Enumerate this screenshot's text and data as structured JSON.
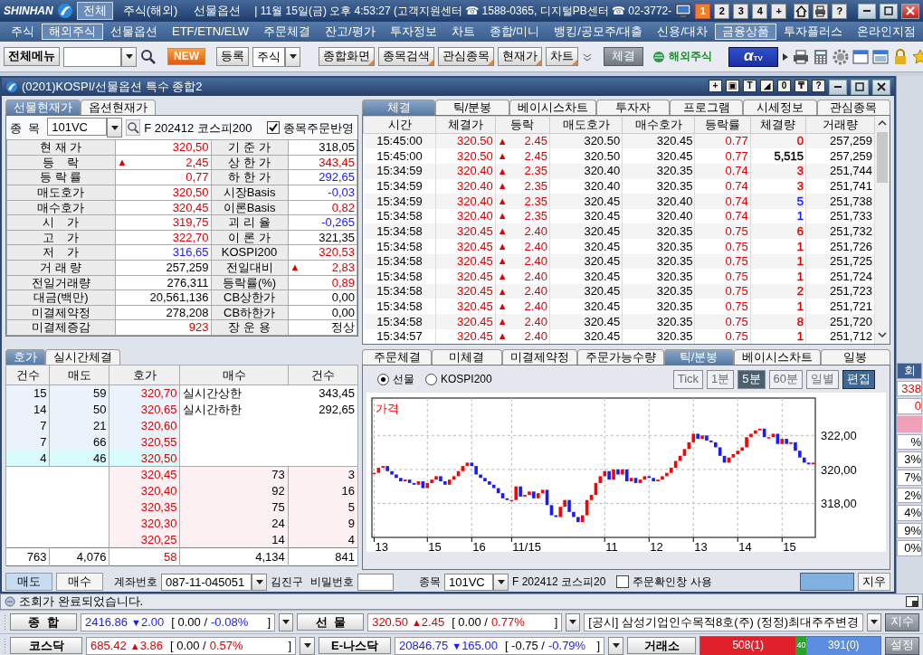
{
  "topbar": {
    "logo": "SHINHAN",
    "tabs": [
      {
        "label": "전체",
        "selected": true
      },
      {
        "label": "주식(해외)",
        "selected": false
      },
      {
        "label": "선물옵션",
        "selected": false
      }
    ],
    "info": "| 11월 15일(금) 오후 4:53:27 (고객지원센터 ☎ 1588-0365, 디지털PB센터 ☎ 02-3772-",
    "screens": [
      {
        "label": "1",
        "selected": true
      },
      {
        "label": "2",
        "selected": false
      },
      {
        "label": "3",
        "selected": false
      },
      {
        "label": "4",
        "selected": false
      },
      {
        "label": "+",
        "selected": false
      }
    ],
    "help": "?"
  },
  "menu": [
    {
      "label": "주식",
      "selected": false
    },
    {
      "label": "해외주식",
      "selected": true
    },
    {
      "label": "선물옵션",
      "selected": false
    },
    {
      "label": "ETF/ETN/ELW",
      "selected": false
    },
    {
      "label": "주문체결",
      "selected": false
    },
    {
      "label": "잔고/평가",
      "selected": false
    },
    {
      "label": "투자정보",
      "selected": false
    },
    {
      "label": "차트",
      "selected": false
    },
    {
      "label": "종합/미니",
      "selected": false
    },
    {
      "label": "뱅킹/공모주/대출",
      "selected": false
    },
    {
      "label": "신용/대차",
      "selected": false
    },
    {
      "label": "금융상품",
      "selected": true
    },
    {
      "label": "투자플러스",
      "selected": false
    },
    {
      "label": "온라인지점",
      "selected": false
    }
  ],
  "toolbar": {
    "all_menu": "전체메뉴",
    "new": "NEW",
    "register": "등록",
    "market": "주식",
    "shortcuts": [
      "종합화면",
      "종목검색",
      "관심종목",
      "현재가",
      "차트"
    ],
    "fills": "체결",
    "overseas": "해외주식",
    "tv_mark": "α",
    "tv": "TV"
  },
  "window": {
    "title": "(0201)KOSPI/선물옵션 특수 종합2",
    "tools": [
      "+",
      "▣",
      "T",
      "◢",
      "0",
      "₸",
      "?"
    ]
  },
  "quote": {
    "tabs": [
      {
        "label": "선물현재가",
        "selected": true
      },
      {
        "label": "옵션현재가",
        "selected": false
      }
    ],
    "symbol_label": "종  목",
    "symbol": "101VC",
    "symbol_name": "F 202412 코스피200",
    "reflect": {
      "label": "종목주문반영",
      "checked": true
    },
    "rows": [
      {
        "left": {
          "label": "현 재 가",
          "value": "320,50",
          "color": "#e00000"
        },
        "right": {
          "label": "기 준 가",
          "value": "318,05",
          "color": "#000000"
        }
      },
      {
        "left": {
          "label": "등    락",
          "mark": "▲",
          "value": "2,45",
          "color": "#e00000"
        },
        "right": {
          "label": "상 한 가",
          "value": "343,45",
          "color": "#e00000"
        }
      },
      {
        "left": {
          "label": "등 락 률",
          "value": "0,77",
          "color": "#e00000"
        },
        "right": {
          "label": "하 한 가",
          "value": "292,65",
          "color": "#1a1aff"
        }
      },
      {
        "left": {
          "label": "매도호가",
          "value": "320,50",
          "color": "#e00000"
        },
        "right": {
          "label": "시장Basis",
          "value": "-0,03",
          "color": "#1a1aff"
        }
      },
      {
        "left": {
          "label": "매수호가",
          "value": "320,45",
          "color": "#e00000"
        },
        "right": {
          "label": "이론Basis",
          "value": "0,82",
          "color": "#e00000"
        }
      },
      {
        "left": {
          "label": "시    가",
          "value": "319,75",
          "color": "#e00000"
        },
        "right": {
          "label": "괴 리 율",
          "value": "-0,265",
          "color": "#1a1aff"
        }
      },
      {
        "left": {
          "label": "고    가",
          "value": "322,70",
          "color": "#e00000"
        },
        "right": {
          "label": "이 론 가",
          "value": "321,35",
          "color": "#000000"
        }
      },
      {
        "left": {
          "label": "저    가",
          "value": "316,65",
          "color": "#1a1aff"
        },
        "right": {
          "label": "KOSPI200",
          "value": "320,53",
          "color": "#e00000"
        }
      },
      {
        "left": {
          "label": "거 래 량",
          "value": "257,259",
          "color": "#000000"
        },
        "right": {
          "label": "전일대비",
          "mark": "▲",
          "value": "2,83",
          "color": "#e00000"
        }
      },
      {
        "left": {
          "label": "전일거래량",
          "value": "276,311",
          "color": "#000000"
        },
        "right": {
          "label": "등락률(%)",
          "value": "0,89",
          "color": "#e00000"
        }
      },
      {
        "left": {
          "label": "대금(백만)",
          "value": "20,561,136",
          "color": "#000000"
        },
        "right": {
          "label": "CB상한가",
          "value": "0,00",
          "color": "#000000"
        }
      },
      {
        "left": {
          "label": "미결제약정",
          "value": "278,208",
          "color": "#000000"
        },
        "right": {
          "label": "CB하한가",
          "value": "0,00",
          "color": "#000000"
        }
      },
      {
        "left": {
          "label": "미결제증감",
          "value": "923",
          "color": "#e00000"
        },
        "right": {
          "label": "장 운 용",
          "value": "정상",
          "color": "#000000"
        }
      }
    ]
  },
  "trades": {
    "tabs": [
      {
        "label": "체결",
        "selected": true
      },
      {
        "label": "틱/분봉",
        "selected": false
      },
      {
        "label": "베이시스차트",
        "selected": false
      },
      {
        "label": "투자자",
        "selected": false
      },
      {
        "label": "프로그램",
        "selected": false
      },
      {
        "label": "시세정보",
        "selected": false
      },
      {
        "label": "관심종목",
        "selected": false
      }
    ],
    "columns": [
      "시간",
      "체결가",
      "등락",
      "매도호가",
      "매수호가",
      "등락률",
      "체결량",
      "거래량"
    ],
    "rows": [
      {
        "time": "15:45:00",
        "price": "320.50",
        "mark": "▲",
        "change": "2.45",
        "ask": "320.50",
        "bid": "320.45",
        "rate": "0.77",
        "qty": {
          "text": "0",
          "color": "#e00000"
        },
        "volume": "257,259"
      },
      {
        "time": "15:45:00",
        "price": "320.50",
        "mark": "▲",
        "change": "2.45",
        "ask": "320.50",
        "bid": "320.45",
        "rate": "0.77",
        "qty": {
          "text": "5,515",
          "color": "#000000"
        },
        "volume": "257,259"
      },
      {
        "time": "15:34:59",
        "price": "320.40",
        "mark": "▲",
        "change": "2.35",
        "ask": "320.40",
        "bid": "320.35",
        "rate": "0.74",
        "qty": {
          "text": "3",
          "color": "#e00000"
        },
        "volume": "251,744"
      },
      {
        "time": "15:34:59",
        "price": "320.40",
        "mark": "▲",
        "change": "2.35",
        "ask": "320.40",
        "bid": "320.35",
        "rate": "0.74",
        "qty": {
          "text": "3",
          "color": "#e00000"
        },
        "volume": "251,741"
      },
      {
        "time": "15:34:59",
        "price": "320.40",
        "mark": "▲",
        "change": "2.35",
        "ask": "320.45",
        "bid": "320.40",
        "rate": "0.74",
        "qty": {
          "text": "5",
          "color": "#1a1aff"
        },
        "volume": "251,738"
      },
      {
        "time": "15:34:58",
        "price": "320.40",
        "mark": "▲",
        "change": "2.35",
        "ask": "320.45",
        "bid": "320.40",
        "rate": "0.74",
        "qty": {
          "text": "1",
          "color": "#1a1aff"
        },
        "volume": "251,733"
      },
      {
        "time": "15:34:58",
        "price": "320.45",
        "mark": "▲",
        "change": "2.40",
        "ask": "320.45",
        "bid": "320.35",
        "rate": "0.75",
        "qty": {
          "text": "6",
          "color": "#e00000"
        },
        "volume": "251,732"
      },
      {
        "time": "15:34:58",
        "price": "320.45",
        "mark": "▲",
        "change": "2.40",
        "ask": "320.45",
        "bid": "320.35",
        "rate": "0.75",
        "qty": {
          "text": "1",
          "color": "#e00000"
        },
        "volume": "251,726"
      },
      {
        "time": "15:34:58",
        "price": "320.45",
        "mark": "▲",
        "change": "2.40",
        "ask": "320.45",
        "bid": "320.35",
        "rate": "0.75",
        "qty": {
          "text": "1",
          "color": "#e00000"
        },
        "volume": "251,725"
      },
      {
        "time": "15:34:58",
        "price": "320.45",
        "mark": "▲",
        "change": "2.40",
        "ask": "320.45",
        "bid": "320.35",
        "rate": "0.75",
        "qty": {
          "text": "1",
          "color": "#e00000"
        },
        "volume": "251,724"
      },
      {
        "time": "15:34:58",
        "price": "320.45",
        "mark": "▲",
        "change": "2.40",
        "ask": "320.45",
        "bid": "320.35",
        "rate": "0.75",
        "qty": {
          "text": "2",
          "color": "#e00000"
        },
        "volume": "251,723"
      },
      {
        "time": "15:34:58",
        "price": "320.45",
        "mark": "▲",
        "change": "2.40",
        "ask": "320.45",
        "bid": "320.35",
        "rate": "0.75",
        "qty": {
          "text": "1",
          "color": "#e00000"
        },
        "volume": "251,721"
      },
      {
        "time": "15:34:58",
        "price": "320.45",
        "mark": "▲",
        "change": "2.40",
        "ask": "320.45",
        "bid": "320.35",
        "rate": "0.75",
        "qty": {
          "text": "8",
          "color": "#e00000"
        },
        "volume": "251,720"
      },
      {
        "time": "15:34:57",
        "price": "320.45",
        "mark": "▲",
        "change": "2.40",
        "ask": "320.45",
        "bid": "320.35",
        "rate": "0.75",
        "qty": {
          "text": "1",
          "color": "#e00000"
        },
        "volume": "251,712"
      }
    ]
  },
  "orderbook": {
    "tabs": [
      {
        "label": "호가",
        "selected": true
      },
      {
        "label": "실시간체결",
        "selected": false
      }
    ],
    "columns": [
      "건수",
      "매도",
      "호가",
      "매수",
      "건수"
    ],
    "asks": [
      {
        "count": "15",
        "qty": "59",
        "price": "320,70",
        "best": false
      },
      {
        "count": "14",
        "qty": "50",
        "price": "320,65",
        "best": false
      },
      {
        "count": "7",
        "qty": "21",
        "price": "320,60",
        "best": false
      },
      {
        "count": "7",
        "qty": "66",
        "price": "320,55",
        "best": false
      },
      {
        "count": "4",
        "qty": "46",
        "price": "320,50",
        "best": true
      }
    ],
    "limits": [
      {
        "label": "실시간상한",
        "value": "343,45"
      },
      {
        "label": "실시간하한",
        "value": "292,65"
      }
    ],
    "bids": [
      {
        "price": "320,45",
        "qty": "73",
        "count": "3"
      },
      {
        "price": "320,40",
        "qty": "92",
        "count": "16"
      },
      {
        "price": "320,35",
        "qty": "75",
        "count": "5"
      },
      {
        "price": "320,30",
        "qty": "24",
        "count": "9"
      },
      {
        "price": "320,25",
        "qty": "14",
        "count": "4"
      }
    ],
    "totals": [
      "763",
      "4,076",
      "58",
      "4,134",
      "841"
    ]
  },
  "chart_panel": {
    "tabs": [
      {
        "label": "주문체결",
        "selected": false
      },
      {
        "label": "미체결",
        "selected": false
      },
      {
        "label": "미결제약정",
        "selected": false
      },
      {
        "label": "주문가능수량",
        "selected": false
      },
      {
        "label": "틱/분봉",
        "selected": true
      },
      {
        "label": "베이시스차트",
        "selected": false
      },
      {
        "label": "일봉",
        "selected": false
      }
    ],
    "sources": [
      {
        "label": "선물",
        "selected": true
      },
      {
        "label": "KOSPI200",
        "selected": false
      }
    ],
    "periods": [
      {
        "label": "Tick",
        "selected": false
      },
      {
        "label": "1분",
        "selected": false
      },
      {
        "label": "5분",
        "selected": true
      },
      {
        "label": "60분",
        "selected": false
      },
      {
        "label": "일별",
        "selected": false
      }
    ],
    "edit": "편집",
    "chart": {
      "label": "가격",
      "y_labels": [
        "322,00",
        "320,00",
        "318,00"
      ],
      "x_labels": [
        "13",
        "15",
        "16",
        "11/15",
        "11",
        "12",
        "13",
        "14",
        "15"
      ]
    }
  },
  "order": {
    "sides": [
      {
        "label": "매도",
        "selected": true
      },
      {
        "label": "매수",
        "selected": false
      }
    ],
    "account_label": "계좌번호",
    "account": "087-11-045051",
    "owner": "김진구",
    "password_label": "비밀번호",
    "symbol_label": "종목",
    "symbol": "101VC",
    "symbol_name": "F 202412 코스피20",
    "confirm": {
      "label": "주문확인창 사용",
      "checked": false
    },
    "clear": "지우"
  },
  "side_strip": [
    {
      "text": "회",
      "kind": "header"
    },
    {
      "text": "338",
      "kind": "up"
    },
    {
      "text": "0",
      "kind": "up"
    },
    {
      "text": "%",
      "kind": "plain"
    },
    {
      "text": "3%",
      "kind": "plain"
    },
    {
      "text": "7%",
      "kind": "plain"
    },
    {
      "text": "2%",
      "kind": "plain"
    },
    {
      "text": "4%",
      "kind": "plain"
    },
    {
      "text": "9%",
      "kind": "plain"
    },
    {
      "text": "0%",
      "kind": "plain"
    }
  ],
  "status": "조회가 완료되었습니다.",
  "tickers": [
    {
      "items": [
        {
          "label": "종  합",
          "value": "2416.86",
          "color": "#1a1aff",
          "mark": "▼",
          "change": "2.00",
          "net": "[ 0.00 /",
          "pct": {
            "text": "-0.08%",
            "color": "#1a1aff"
          },
          "end": "]"
        },
        {
          "label": "선  물",
          "value": "320.50",
          "color": "#e00000",
          "mark": "▲",
          "change": "2.45",
          "net": "[ 0.00 /",
          "pct": {
            "text": "0.77%",
            "color": "#e00000"
          },
          "end": "]"
        }
      ],
      "news": "[공시] 삼성기업인수목적8호(주) (정정)최대주주변경",
      "button": "지수"
    },
    {
      "items": [
        {
          "label": "코스닥",
          "value": "685.42",
          "color": "#e00000",
          "mark": "▲",
          "change": "3.86",
          "net": "[ 0.00 /",
          "pct": {
            "text": "0.57%",
            "color": "#e00000"
          },
          "end": "]"
        },
        {
          "label": "E-나스닥",
          "value": "20846.75",
          "color": "#1a1aff",
          "mark": "▼",
          "change": "165.00",
          "net": "[ -0.75 /",
          "pct": {
            "text": "-0.79%",
            "color": "#1a1aff"
          },
          "end": "]"
        }
      ],
      "exchange": {
        "label": "거래소",
        "segments": [
          {
            "text": "508(1)",
            "kind": "rise",
            "color": "#e0202a"
          },
          {
            "text": "40",
            "kind": "flat",
            "color": "#2ca02c"
          },
          {
            "text": "391(0)",
            "kind": "fall",
            "color": "#5b8de0"
          }
        ]
      },
      "button": "설정"
    }
  ]
}
